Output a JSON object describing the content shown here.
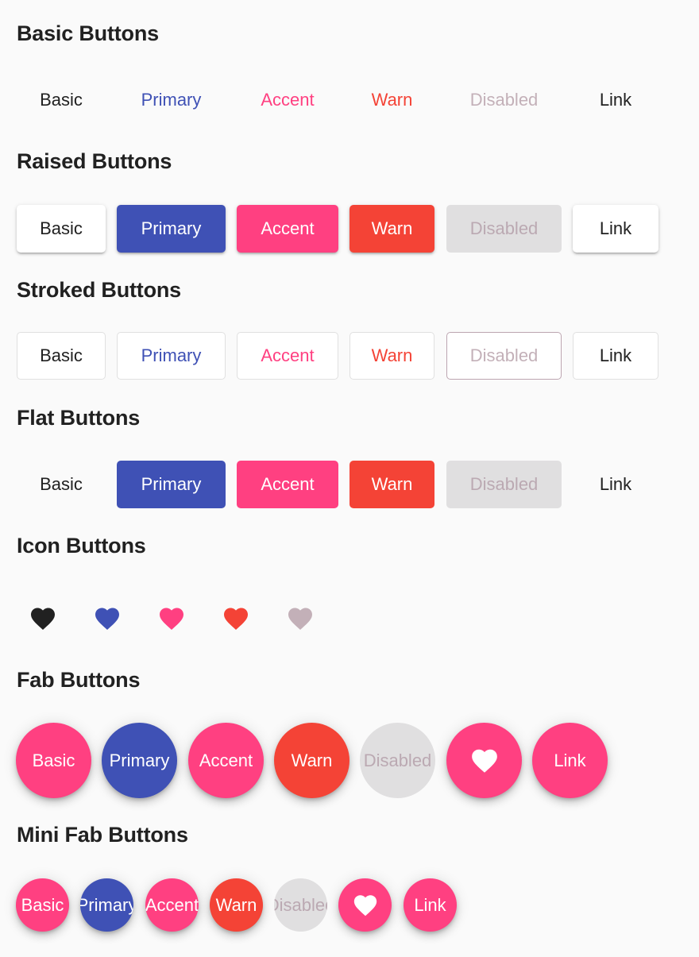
{
  "sections": {
    "basic": "Basic Buttons",
    "raised": "Raised Buttons",
    "stroked": "Stroked Buttons",
    "flat": "Flat Buttons",
    "icon": "Icon Buttons",
    "fab": "Fab Buttons",
    "mini_fab": "Mini Fab Buttons"
  },
  "labels": {
    "basic": "Basic",
    "primary": "Primary",
    "accent": "Accent",
    "warn": "Warn",
    "disabled": "Disabled",
    "link": "Link"
  },
  "icons": {
    "favorite": "heart-icon"
  },
  "colors": {
    "primary": "#3f51b5",
    "accent": "#ff4081",
    "warn": "#f44336",
    "disabled": "#c3b0b8",
    "text": "#212121"
  }
}
